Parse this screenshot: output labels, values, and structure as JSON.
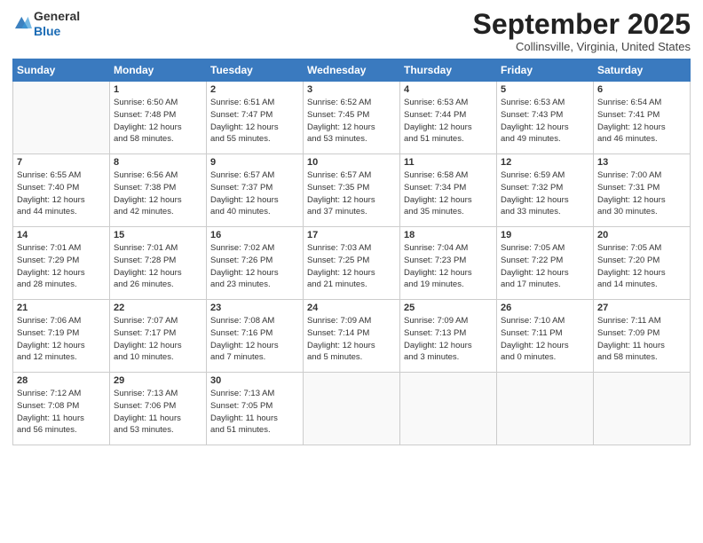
{
  "header": {
    "logo_line1": "General",
    "logo_line2": "Blue",
    "month": "September 2025",
    "location": "Collinsville, Virginia, United States"
  },
  "weekdays": [
    "Sunday",
    "Monday",
    "Tuesday",
    "Wednesday",
    "Thursday",
    "Friday",
    "Saturday"
  ],
  "weeks": [
    [
      {
        "day": "",
        "info": ""
      },
      {
        "day": "1",
        "info": "Sunrise: 6:50 AM\nSunset: 7:48 PM\nDaylight: 12 hours\nand 58 minutes."
      },
      {
        "day": "2",
        "info": "Sunrise: 6:51 AM\nSunset: 7:47 PM\nDaylight: 12 hours\nand 55 minutes."
      },
      {
        "day": "3",
        "info": "Sunrise: 6:52 AM\nSunset: 7:45 PM\nDaylight: 12 hours\nand 53 minutes."
      },
      {
        "day": "4",
        "info": "Sunrise: 6:53 AM\nSunset: 7:44 PM\nDaylight: 12 hours\nand 51 minutes."
      },
      {
        "day": "5",
        "info": "Sunrise: 6:53 AM\nSunset: 7:43 PM\nDaylight: 12 hours\nand 49 minutes."
      },
      {
        "day": "6",
        "info": "Sunrise: 6:54 AM\nSunset: 7:41 PM\nDaylight: 12 hours\nand 46 minutes."
      }
    ],
    [
      {
        "day": "7",
        "info": "Sunrise: 6:55 AM\nSunset: 7:40 PM\nDaylight: 12 hours\nand 44 minutes."
      },
      {
        "day": "8",
        "info": "Sunrise: 6:56 AM\nSunset: 7:38 PM\nDaylight: 12 hours\nand 42 minutes."
      },
      {
        "day": "9",
        "info": "Sunrise: 6:57 AM\nSunset: 7:37 PM\nDaylight: 12 hours\nand 40 minutes."
      },
      {
        "day": "10",
        "info": "Sunrise: 6:57 AM\nSunset: 7:35 PM\nDaylight: 12 hours\nand 37 minutes."
      },
      {
        "day": "11",
        "info": "Sunrise: 6:58 AM\nSunset: 7:34 PM\nDaylight: 12 hours\nand 35 minutes."
      },
      {
        "day": "12",
        "info": "Sunrise: 6:59 AM\nSunset: 7:32 PM\nDaylight: 12 hours\nand 33 minutes."
      },
      {
        "day": "13",
        "info": "Sunrise: 7:00 AM\nSunset: 7:31 PM\nDaylight: 12 hours\nand 30 minutes."
      }
    ],
    [
      {
        "day": "14",
        "info": "Sunrise: 7:01 AM\nSunset: 7:29 PM\nDaylight: 12 hours\nand 28 minutes."
      },
      {
        "day": "15",
        "info": "Sunrise: 7:01 AM\nSunset: 7:28 PM\nDaylight: 12 hours\nand 26 minutes."
      },
      {
        "day": "16",
        "info": "Sunrise: 7:02 AM\nSunset: 7:26 PM\nDaylight: 12 hours\nand 23 minutes."
      },
      {
        "day": "17",
        "info": "Sunrise: 7:03 AM\nSunset: 7:25 PM\nDaylight: 12 hours\nand 21 minutes."
      },
      {
        "day": "18",
        "info": "Sunrise: 7:04 AM\nSunset: 7:23 PM\nDaylight: 12 hours\nand 19 minutes."
      },
      {
        "day": "19",
        "info": "Sunrise: 7:05 AM\nSunset: 7:22 PM\nDaylight: 12 hours\nand 17 minutes."
      },
      {
        "day": "20",
        "info": "Sunrise: 7:05 AM\nSunset: 7:20 PM\nDaylight: 12 hours\nand 14 minutes."
      }
    ],
    [
      {
        "day": "21",
        "info": "Sunrise: 7:06 AM\nSunset: 7:19 PM\nDaylight: 12 hours\nand 12 minutes."
      },
      {
        "day": "22",
        "info": "Sunrise: 7:07 AM\nSunset: 7:17 PM\nDaylight: 12 hours\nand 10 minutes."
      },
      {
        "day": "23",
        "info": "Sunrise: 7:08 AM\nSunset: 7:16 PM\nDaylight: 12 hours\nand 7 minutes."
      },
      {
        "day": "24",
        "info": "Sunrise: 7:09 AM\nSunset: 7:14 PM\nDaylight: 12 hours\nand 5 minutes."
      },
      {
        "day": "25",
        "info": "Sunrise: 7:09 AM\nSunset: 7:13 PM\nDaylight: 12 hours\nand 3 minutes."
      },
      {
        "day": "26",
        "info": "Sunrise: 7:10 AM\nSunset: 7:11 PM\nDaylight: 12 hours\nand 0 minutes."
      },
      {
        "day": "27",
        "info": "Sunrise: 7:11 AM\nSunset: 7:09 PM\nDaylight: 11 hours\nand 58 minutes."
      }
    ],
    [
      {
        "day": "28",
        "info": "Sunrise: 7:12 AM\nSunset: 7:08 PM\nDaylight: 11 hours\nand 56 minutes."
      },
      {
        "day": "29",
        "info": "Sunrise: 7:13 AM\nSunset: 7:06 PM\nDaylight: 11 hours\nand 53 minutes."
      },
      {
        "day": "30",
        "info": "Sunrise: 7:13 AM\nSunset: 7:05 PM\nDaylight: 11 hours\nand 51 minutes."
      },
      {
        "day": "",
        "info": ""
      },
      {
        "day": "",
        "info": ""
      },
      {
        "day": "",
        "info": ""
      },
      {
        "day": "",
        "info": ""
      }
    ]
  ]
}
